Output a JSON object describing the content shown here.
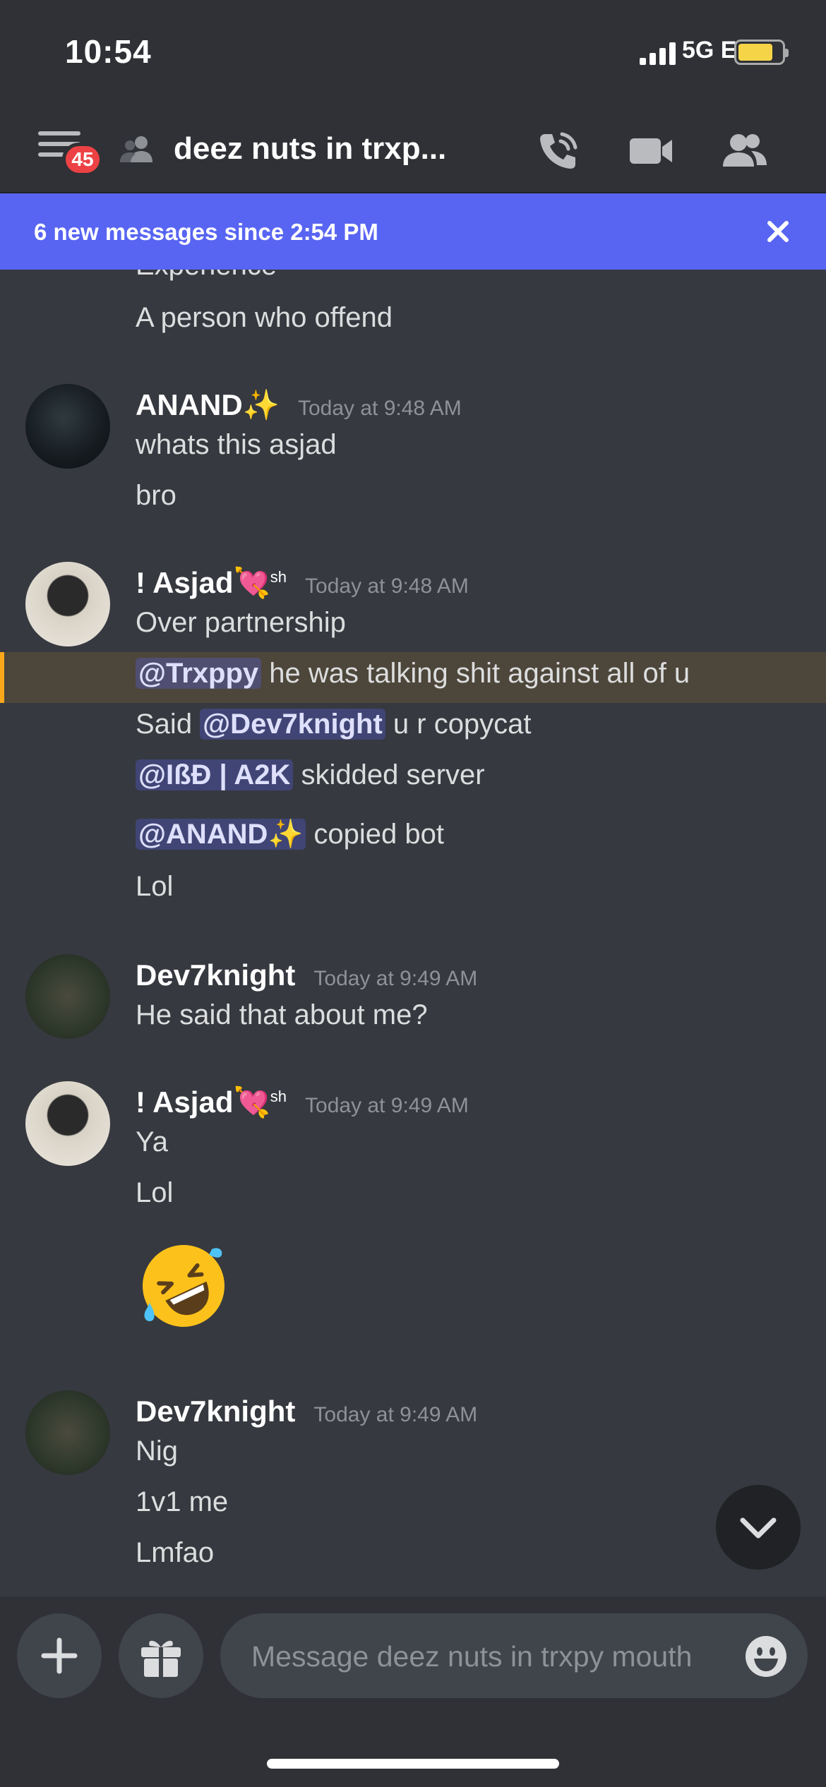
{
  "status": {
    "time": "10:54",
    "network": "5G E"
  },
  "header": {
    "badge": "45",
    "title": "deez nuts in trxp..."
  },
  "new_messages": {
    "text": "6 new messages since 2:54 PM"
  },
  "messages": {
    "partial_top": {
      "line1": "Experience",
      "line2": "A person who offend"
    },
    "anand": {
      "author": "ANAND✨",
      "time": "Today at 9:48 AM",
      "lines": [
        "whats this asjad",
        "bro"
      ]
    },
    "asjad1": {
      "author": "! Asjad💘",
      "tag": "sh",
      "time": "Today at 9:48 AM",
      "line1": "Over partnership",
      "line2_mention": "@Trxppy",
      "line2_text": " he was talking shit against all of u",
      "line3_pre": "Said ",
      "line3_mention": "@Dev7knight",
      "line3_text": " u r copycat",
      "line4_mention": "@IßÐ | A2K",
      "line4_text": " skidded server",
      "line5_mention": "@ANAND✨",
      "line5_text": " copied bot",
      "line6": "Lol"
    },
    "dev1": {
      "author": "Dev7knight",
      "time": "Today at 9:49 AM",
      "line1": "He said that about me?"
    },
    "asjad2": {
      "author": "! Asjad💘",
      "tag": "sh",
      "time": "Today at 9:49 AM",
      "line1": "Ya",
      "line2": "Lol",
      "emoji": "rolling-on-floor-laughing"
    },
    "dev2": {
      "author": "Dev7knight",
      "time": "Today at 9:49 AM",
      "lines": [
        "Nig",
        "1v1 me",
        "Lmfao"
      ]
    }
  },
  "composer": {
    "placeholder": "Message deez nuts in trxpy mouth"
  },
  "colors": {
    "accent": "#5865f2",
    "background": "#36393f",
    "header": "#2f3136",
    "highlight": "#faa81a",
    "badge": "#ed4245"
  }
}
